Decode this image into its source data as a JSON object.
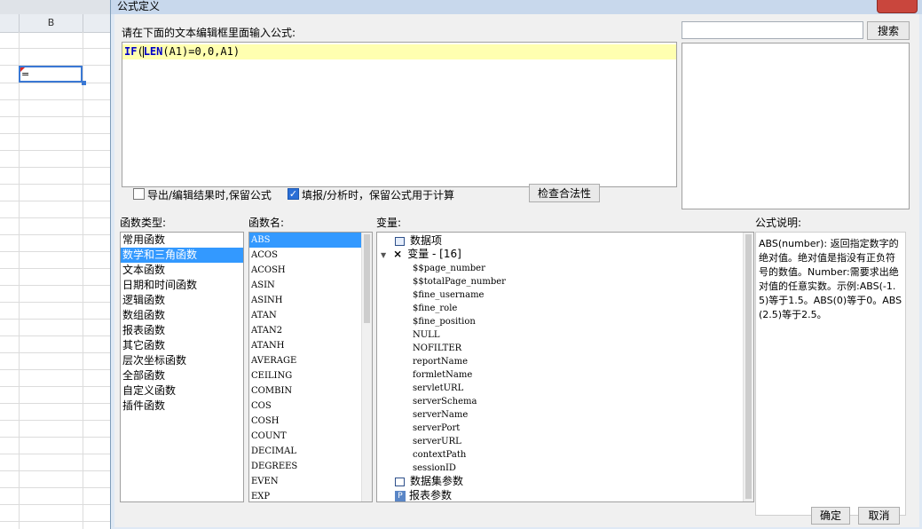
{
  "spreadsheet": {
    "column_header": "B",
    "cell_value": "="
  },
  "dialog": {
    "title": "公式定义",
    "editor_label": "请在下面的文本编辑框里面输入公式:",
    "formula": {
      "keyword1": "IF",
      "paren": "(",
      "keyword2": "LEN",
      "rest": "(A1)=0,0,A1)"
    },
    "search_input_value": "",
    "search_button": "搜索",
    "checkbox_export": {
      "label": "导出/编辑结果时,保留公式",
      "checked": false
    },
    "checkbox_fill": {
      "label": "填报/分析时，保留公式用于计算",
      "checked": true
    },
    "check_button": "检查合法性",
    "function_type_label": "函数类型:",
    "function_types": [
      "常用函数",
      "数学和三角函数",
      "文本函数",
      "日期和时间函数",
      "逻辑函数",
      "数组函数",
      "报表函数",
      "其它函数",
      "层次坐标函数",
      "全部函数",
      "自定义函数",
      "插件函数"
    ],
    "function_types_selected": 1,
    "function_name_label": "函数名:",
    "function_names": [
      "ABS",
      "ACOS",
      "ACOSH",
      "ASIN",
      "ASINH",
      "ATAN",
      "ATAN2",
      "ATANH",
      "AVERAGE",
      "CEILING",
      "COMBIN",
      "COS",
      "COSH",
      "COUNT",
      "DECIMAL",
      "DEGREES",
      "EVEN",
      "EXP"
    ],
    "function_names_selected": 0,
    "variables_label": "变量:",
    "variables": {
      "data_item": "数据项",
      "var_group": "变量 - [16]",
      "var_items": [
        "$$page_number",
        "$$totalPage_number",
        "$fine_username",
        "$fine_role",
        "$fine_position",
        "NULL",
        "NOFILTER",
        "reportName",
        "formletName",
        "servletURL",
        "serverSchema",
        "serverName",
        "serverPort",
        "serverURL",
        "contextPath",
        "sessionID"
      ],
      "dataset_params": "数据集参数",
      "report_params": "报表参数"
    },
    "description_label": "公式说明:",
    "description": "ABS(number): 返回指定数字的绝对值。绝对值是指没有正负符号的数值。Number:需要求出绝对值的任意实数。示例:ABS(-1.5)等于1.5。ABS(0)等于0。ABS(2.5)等于2.5。",
    "ok_button": "确定",
    "cancel_button": "取消"
  },
  "colors": {
    "selection": "#3399ff",
    "formula_line_bg": "#ffffb0",
    "checkbox_checked": "#2b6fd6",
    "close_button": "#c9463d"
  }
}
